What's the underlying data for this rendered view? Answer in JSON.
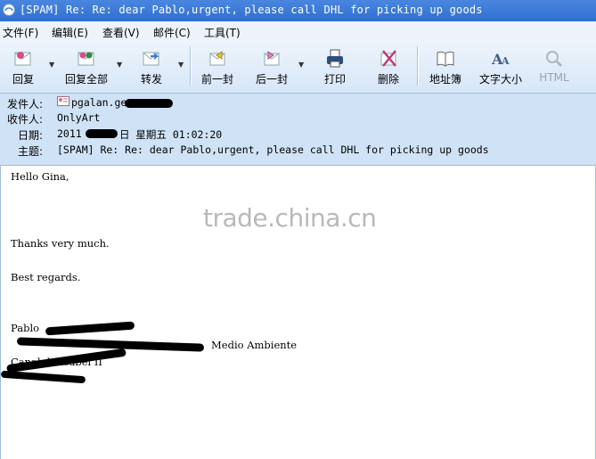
{
  "window": {
    "title": "[SPAM] Re: Re: dear Pablo,urgent, please call DHL for picking up goods"
  },
  "menu": [
    "文件(F)",
    "编辑(E)",
    "查看(V)",
    "邮件(C)",
    "工具(T)"
  ],
  "toolbar": {
    "reply": "回复",
    "reply_all": "回复全部",
    "forward": "转发",
    "previous": "前一封",
    "next": "后一封",
    "print": "打印",
    "delete": "删除",
    "address_book": "地址簿",
    "text_size": "文字大小",
    "html": "HTML"
  },
  "header": {
    "from_label": "发件人:",
    "from_value": "pgalan.ge",
    "to_label": "收件人:",
    "to_value": "OnlyArt",
    "date_label": "日期:",
    "date_value_prefix": "2011",
    "date_value_suffix": "日 星期五 01:02:20",
    "subject_label": "主题:",
    "subject_value": "[SPAM] Re: Re: dear Pablo,urgent, please call DHL for picking up goods"
  },
  "body": {
    "greeting": "Hello Gina,",
    "thanks": "Thanks very much.",
    "regards": "Best regards.",
    "sig_name": "Pablo",
    "sig_dept_end": "Medio Ambiente",
    "sig_company": "Canal de Isabel II"
  },
  "watermark": "trade.china.cn"
}
